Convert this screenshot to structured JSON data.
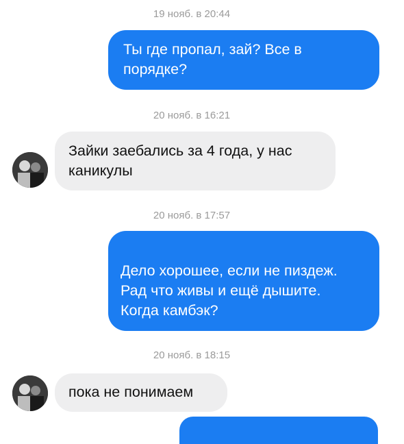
{
  "messages": [
    {
      "timestamp": "19 нояб. в 20:44",
      "direction": "outgoing",
      "text": "Ты где пропал, зай? Все в порядке?"
    },
    {
      "timestamp": "20 нояб. в 16:21",
      "direction": "incoming",
      "text": "Зайки заебались за 4 года, у нас каникулы"
    },
    {
      "timestamp": "20 нояб. в 17:57",
      "direction": "outgoing",
      "text": "Дело хорошее, если не пиздеж. Рад что живы и ещё дышите.\nКогда камбэк?"
    },
    {
      "timestamp": "20 нояб. в 18:15",
      "direction": "incoming",
      "text": "пока не понимаем"
    }
  ],
  "colors": {
    "outgoing_bubble": "#1b7df2",
    "incoming_bubble": "#eeeeef"
  }
}
